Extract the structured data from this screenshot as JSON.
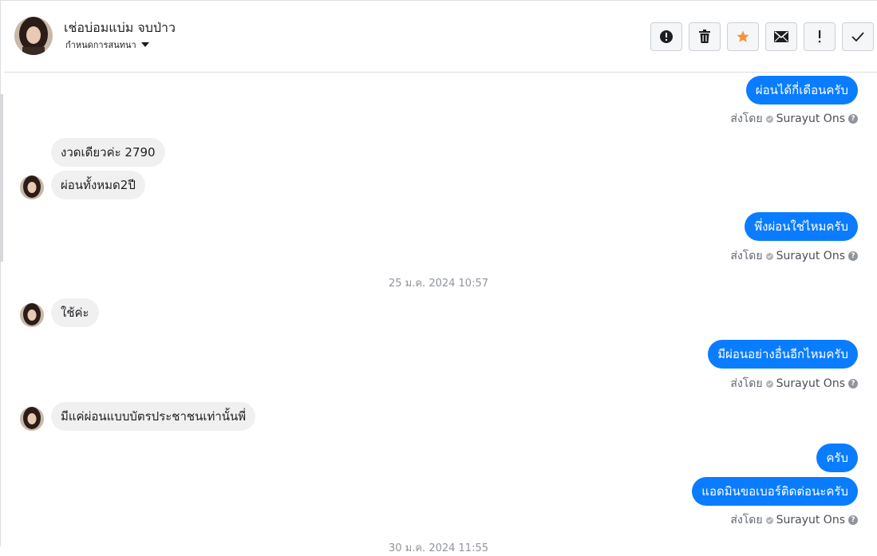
{
  "header": {
    "contact_name": "เช่อบ่อมแบ่ม จบป่าว",
    "subtitle": "กำหนดการสนทนา",
    "toolbar": [
      {
        "icon": "alert-circle-icon"
      },
      {
        "icon": "trash-icon"
      },
      {
        "icon": "star-icon",
        "color": "#f7923a"
      },
      {
        "icon": "envelope-icon"
      },
      {
        "icon": "exclamation-icon"
      },
      {
        "icon": "check-icon"
      }
    ]
  },
  "sent_by_label": "ส่งโดย",
  "agent_name": "Surayut Ons",
  "messages": [
    {
      "text": "ผ่อนได้กี่เดือนครับ"
    },
    {
      "text": "งวดเดียวค่ะ 2790"
    },
    {
      "text": "ผ่อนทั้งหมด2ปี"
    },
    {
      "text": "พึ่งผ่อนใช่ไหมครับ"
    },
    {
      "text": "ใช้ค่ะ"
    },
    {
      "text": "มีผ่อนอย่างอื่นอีกไหมครับ"
    },
    {
      "text": "มีแค่ผ่อนแบบบัตรประชาชนเท่านั้นพี่"
    },
    {
      "text": "ครับ"
    },
    {
      "text": "แอดมินขอเบอร์ติดต่อนะครับ"
    }
  ],
  "timestamps": [
    "25 ม.ค. 2024 10:57",
    "30 ม.ค. 2024 11:55"
  ],
  "colors": {
    "outgoing": "#0a7cff",
    "incoming": "#f0f0f0",
    "star": "#f7923a"
  }
}
